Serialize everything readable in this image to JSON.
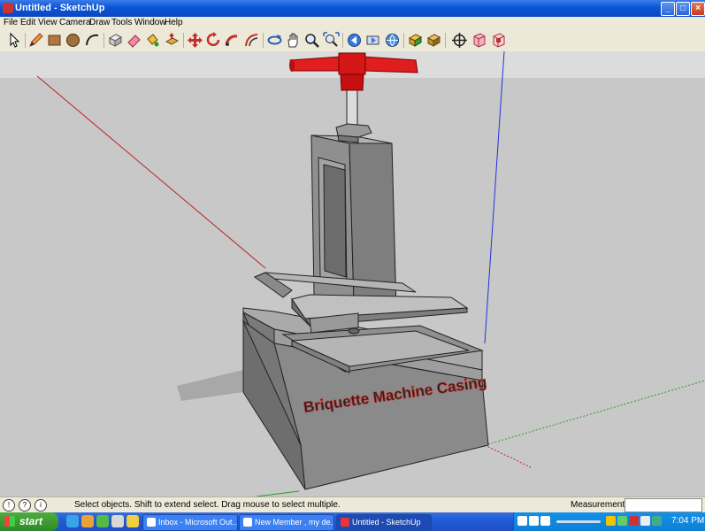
{
  "window": {
    "title": "Untitled - SketchUp",
    "minimize": "_",
    "maximize": "□",
    "close": "×"
  },
  "menu": [
    "File",
    "Edit",
    "View",
    "Camera",
    "Draw",
    "Tools",
    "Window",
    "Help"
  ],
  "toolbar_icons": [
    "select-icon",
    "pencil-icon",
    "rectangle-icon",
    "circle-icon",
    "arc-icon",
    "make-component-icon",
    "eraser-icon",
    "paint-bucket-icon",
    "push-pull-icon",
    "move-icon",
    "rotate-icon",
    "follow-me-icon",
    "offset-icon",
    "orbit-icon",
    "pan-icon",
    "zoom-icon",
    "zoom-extents-icon",
    "previous-view-icon",
    "next-view-icon",
    "get-models-icon",
    "share-model-icon",
    "position-camera-icon",
    "section-plane-icon",
    "x-ray-icon"
  ],
  "model": {
    "label": "Briquette Machine Casing"
  },
  "status": {
    "text": "Select objects. Shift to extend select. Drag mouse to select multiple.",
    "measurements_label": "Measurements",
    "measurements_value": ""
  },
  "taskbar": {
    "start": "start",
    "tasks": [
      {
        "label": "Inbox - Microsoft Out..."
      },
      {
        "label": "New Member , my de..."
      },
      {
        "label": "Untitled - SketchUp"
      }
    ],
    "clock": "7:04 PM"
  },
  "colors": {
    "title_blue": "#0a55d6",
    "handle_red": "#e01e1e",
    "model_grey": "#8a8a8a",
    "sky": "#dcdcdc",
    "ground": "#c8c8c8",
    "start_green": "#3a9b31"
  }
}
